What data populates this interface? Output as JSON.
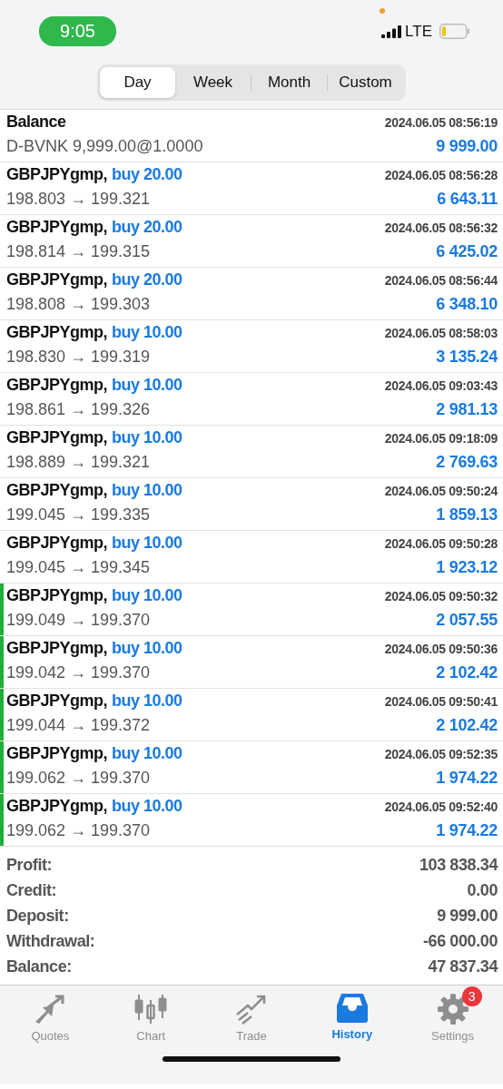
{
  "status_bar": {
    "time": "9:05",
    "network": "LTE"
  },
  "period_tabs": [
    {
      "label": "Day",
      "selected": true
    },
    {
      "label": "Week",
      "selected": false
    },
    {
      "label": "Month",
      "selected": false
    },
    {
      "label": "Custom",
      "selected": false
    }
  ],
  "deals": [
    {
      "kind": "balance",
      "title": "Balance",
      "time": "2024.06.05 08:56:19",
      "detail": "D-BVNK 9,999.00@1.0000",
      "amount": "9 999.00",
      "marked": false
    },
    {
      "kind": "trade",
      "title": "GBPJPYgmp,",
      "action": "buy 20.00",
      "time": "2024.06.05 08:56:28",
      "detail": "198.803 → 199.321",
      "amount": "6 643.11",
      "marked": false
    },
    {
      "kind": "trade",
      "title": "GBPJPYgmp,",
      "action": "buy 20.00",
      "time": "2024.06.05 08:56:32",
      "detail": "198.814 → 199.315",
      "amount": "6 425.02",
      "marked": false
    },
    {
      "kind": "trade",
      "title": "GBPJPYgmp,",
      "action": "buy 20.00",
      "time": "2024.06.05 08:56:44",
      "detail": "198.808 → 199.303",
      "amount": "6 348.10",
      "marked": false
    },
    {
      "kind": "trade",
      "title": "GBPJPYgmp,",
      "action": "buy 10.00",
      "time": "2024.06.05 08:58:03",
      "detail": "198.830 → 199.319",
      "amount": "3 135.24",
      "marked": false
    },
    {
      "kind": "trade",
      "title": "GBPJPYgmp,",
      "action": "buy 10.00",
      "time": "2024.06.05 09:03:43",
      "detail": "198.861 → 199.326",
      "amount": "2 981.13",
      "marked": false
    },
    {
      "kind": "trade",
      "title": "GBPJPYgmp,",
      "action": "buy 10.00",
      "time": "2024.06.05 09:18:09",
      "detail": "198.889 → 199.321",
      "amount": "2 769.63",
      "marked": false
    },
    {
      "kind": "trade",
      "title": "GBPJPYgmp,",
      "action": "buy 10.00",
      "time": "2024.06.05 09:50:24",
      "detail": "199.045 → 199.335",
      "amount": "1 859.13",
      "marked": false
    },
    {
      "kind": "trade",
      "title": "GBPJPYgmp,",
      "action": "buy 10.00",
      "time": "2024.06.05 09:50:28",
      "detail": "199.045 → 199.345",
      "amount": "1 923.12",
      "marked": false
    },
    {
      "kind": "trade",
      "title": "GBPJPYgmp,",
      "action": "buy 10.00",
      "time": "2024.06.05 09:50:32",
      "detail": "199.049 → 199.370",
      "amount": "2 057.55",
      "marked": true
    },
    {
      "kind": "trade",
      "title": "GBPJPYgmp,",
      "action": "buy 10.00",
      "time": "2024.06.05 09:50:36",
      "detail": "199.042 → 199.370",
      "amount": "2 102.42",
      "marked": true
    },
    {
      "kind": "trade",
      "title": "GBPJPYgmp,",
      "action": "buy 10.00",
      "time": "2024.06.05 09:50:41",
      "detail": "199.044 → 199.372",
      "amount": "2 102.42",
      "marked": true
    },
    {
      "kind": "trade",
      "title": "GBPJPYgmp,",
      "action": "buy 10.00",
      "time": "2024.06.05 09:52:35",
      "detail": "199.062 → 199.370",
      "amount": "1 974.22",
      "marked": true
    },
    {
      "kind": "trade",
      "title": "GBPJPYgmp,",
      "action": "buy 10.00",
      "time": "2024.06.05 09:52:40",
      "detail": "199.062 → 199.370",
      "amount": "1 974.22",
      "marked": true
    }
  ],
  "summary": [
    {
      "label": "Profit:",
      "value": "103 838.34"
    },
    {
      "label": "Credit:",
      "value": "0.00"
    },
    {
      "label": "Deposit:",
      "value": "9 999.00"
    },
    {
      "label": "Withdrawal:",
      "value": "-66 000.00"
    },
    {
      "label": "Balance:",
      "value": "47 837.34"
    }
  ],
  "tab_bar": [
    {
      "kind": "quotes",
      "label": "Quotes",
      "selected": false
    },
    {
      "kind": "chart",
      "label": "Chart",
      "selected": false
    },
    {
      "kind": "trade",
      "label": "Trade",
      "selected": false
    },
    {
      "kind": "history",
      "label": "History",
      "selected": true
    },
    {
      "kind": "settings",
      "label": "Settings",
      "selected": false,
      "badge": "3"
    }
  ]
}
